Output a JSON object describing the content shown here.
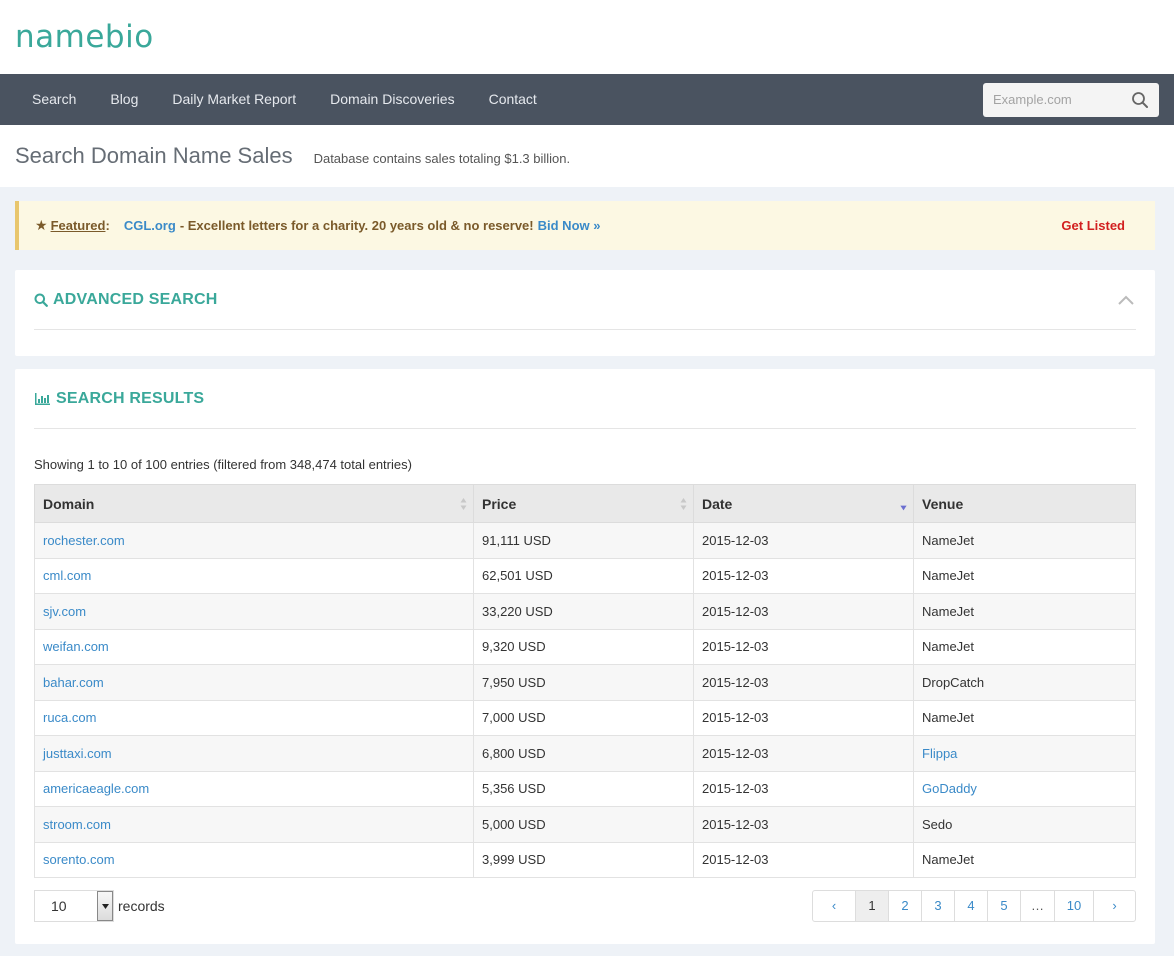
{
  "brand": {
    "logo_text": "namebio"
  },
  "nav": {
    "items": [
      "Search",
      "Blog",
      "Daily Market Report",
      "Domain Discoveries",
      "Contact"
    ],
    "search_placeholder": "Example.com"
  },
  "header": {
    "title": "Search Domain Name Sales",
    "subtitle": "Database contains sales totaling $1.3 billion."
  },
  "featured": {
    "label": "Featured",
    "colon": ":",
    "domain": "CGL.org",
    "description": "- Excellent letters for a charity. 20 years old & no reserve!",
    "bid_label": "Bid Now »",
    "get_listed": "Get Listed"
  },
  "advanced_search": {
    "title": "ADVANCED SEARCH"
  },
  "results": {
    "title": "SEARCH RESULTS",
    "showing": "Showing 1 to 10 of 100 entries (filtered from 348,474 total entries)",
    "columns": [
      "Domain",
      "Price",
      "Date",
      "Venue"
    ],
    "rows": [
      {
        "domain": "rochester.com",
        "price": "91,111 USD",
        "date": "2015-12-03",
        "venue": "NameJet",
        "venue_link": false
      },
      {
        "domain": "cml.com",
        "price": "62,501 USD",
        "date": "2015-12-03",
        "venue": "NameJet",
        "venue_link": false
      },
      {
        "domain": "sjv.com",
        "price": "33,220 USD",
        "date": "2015-12-03",
        "venue": "NameJet",
        "venue_link": false
      },
      {
        "domain": "weifan.com",
        "price": "9,320 USD",
        "date": "2015-12-03",
        "venue": "NameJet",
        "venue_link": false
      },
      {
        "domain": "bahar.com",
        "price": "7,950 USD",
        "date": "2015-12-03",
        "venue": "DropCatch",
        "venue_link": false
      },
      {
        "domain": "ruca.com",
        "price": "7,000 USD",
        "date": "2015-12-03",
        "venue": "NameJet",
        "venue_link": false
      },
      {
        "domain": "justtaxi.com",
        "price": "6,800 USD",
        "date": "2015-12-03",
        "venue": "Flippa",
        "venue_link": true
      },
      {
        "domain": "americaeagle.com",
        "price": "5,356 USD",
        "date": "2015-12-03",
        "venue": "GoDaddy",
        "venue_link": true
      },
      {
        "domain": "stroom.com",
        "price": "5,000 USD",
        "date": "2015-12-03",
        "venue": "Sedo",
        "venue_link": false
      },
      {
        "domain": "sorento.com",
        "price": "3,999 USD",
        "date": "2015-12-03",
        "venue": "NameJet",
        "venue_link": false
      }
    ],
    "page_length": "10",
    "records_label": "records",
    "pagination": [
      "‹",
      "1",
      "2",
      "3",
      "4",
      "5",
      "…",
      "10",
      "›"
    ],
    "active_page": "1"
  },
  "colors": {
    "brand_teal": "#3aa89a",
    "nav_bg": "#4a5360",
    "link_blue": "#3a8ac8",
    "featured_bg": "#fcf8e3",
    "get_listed_red": "#d21f1f"
  },
  "icons": {
    "search": "search-icon",
    "star": "star-icon",
    "chart": "bar-chart-icon",
    "chevron": "chevron-up-icon",
    "sort": "sort-icon",
    "sort_desc": "sort-desc-icon"
  }
}
